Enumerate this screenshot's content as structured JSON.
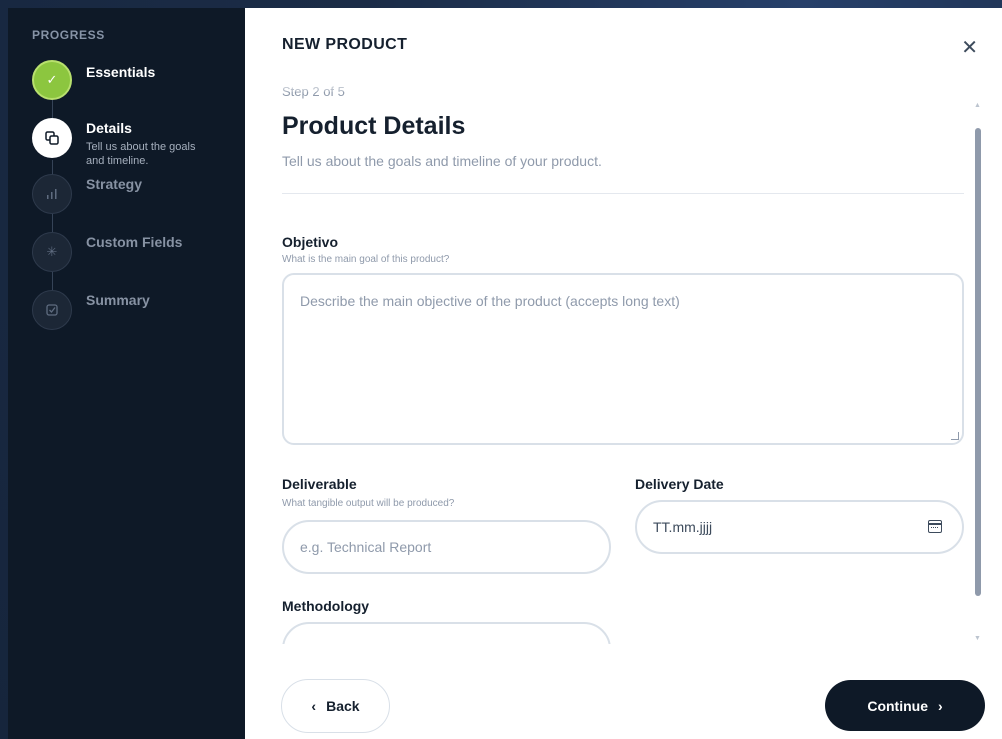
{
  "sidebar": {
    "title": "PROGRESS",
    "steps": [
      {
        "label": "Essentials",
        "status": "done",
        "icon": "check-icon"
      },
      {
        "label": "Details",
        "desc": "Tell us about the goals and timeline.",
        "status": "active",
        "icon": "copy-icon"
      },
      {
        "label": "Strategy",
        "status": "pending",
        "icon": "bar-chart-icon"
      },
      {
        "label": "Custom Fields",
        "status": "pending",
        "icon": "sparkle-icon"
      },
      {
        "label": "Summary",
        "status": "pending",
        "icon": "checkbox-icon"
      }
    ]
  },
  "header": {
    "title": "NEW PRODUCT",
    "close_label": "✕"
  },
  "form": {
    "step_counter": "Step 2 of 5",
    "title": "Product Details",
    "subtitle": "Tell us about the goals and timeline of your product.",
    "objective": {
      "label": "Objetivo",
      "help": "What is the main goal of this product?",
      "placeholder": "Describe the main objective of the product (accepts long text)"
    },
    "deliverable": {
      "label": "Deliverable",
      "help": "What tangible output will be produced?",
      "placeholder": "e.g. Technical Report"
    },
    "delivery_date": {
      "label": "Delivery Date",
      "value": "TT.mm.jjjj"
    },
    "methodology": {
      "label": "Methodology"
    }
  },
  "footer": {
    "back_label": "Back",
    "back_icon": "‹",
    "continue_label": "Continue",
    "continue_icon": "›"
  },
  "colors": {
    "sidebar_bg": "#0e1927",
    "accent_done": "#8cc63f",
    "primary_button": "#0e1927"
  }
}
